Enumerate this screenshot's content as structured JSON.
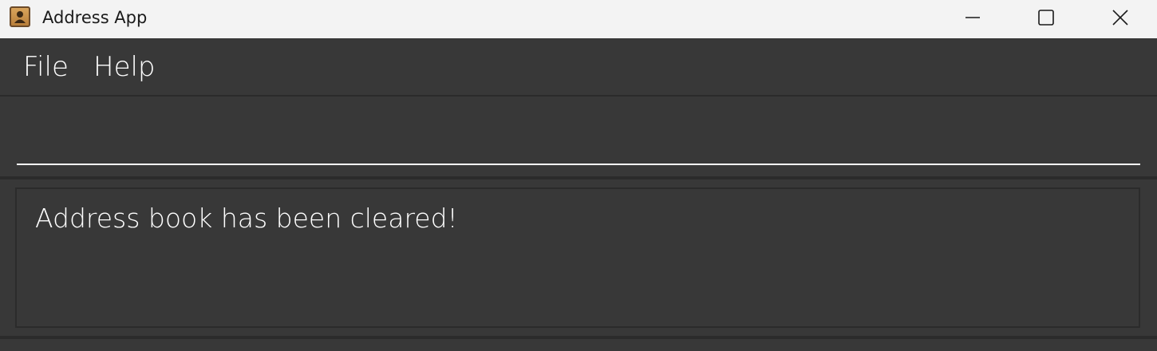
{
  "window": {
    "title": "Address App",
    "icon": "address-book-icon",
    "controls": {
      "minimize_icon": "minimize-icon",
      "maximize_icon": "maximize-icon",
      "close_icon": "close-icon"
    }
  },
  "menubar": {
    "items": [
      {
        "label": "File"
      },
      {
        "label": "Help"
      }
    ]
  },
  "command_box": {
    "value": "",
    "placeholder": ""
  },
  "result_display": {
    "text": "Address book has been cleared!"
  },
  "colors": {
    "background": "#383838",
    "titlebar": "#f3f3f3",
    "text": "#ffffff",
    "border": "#2b2b2b"
  }
}
